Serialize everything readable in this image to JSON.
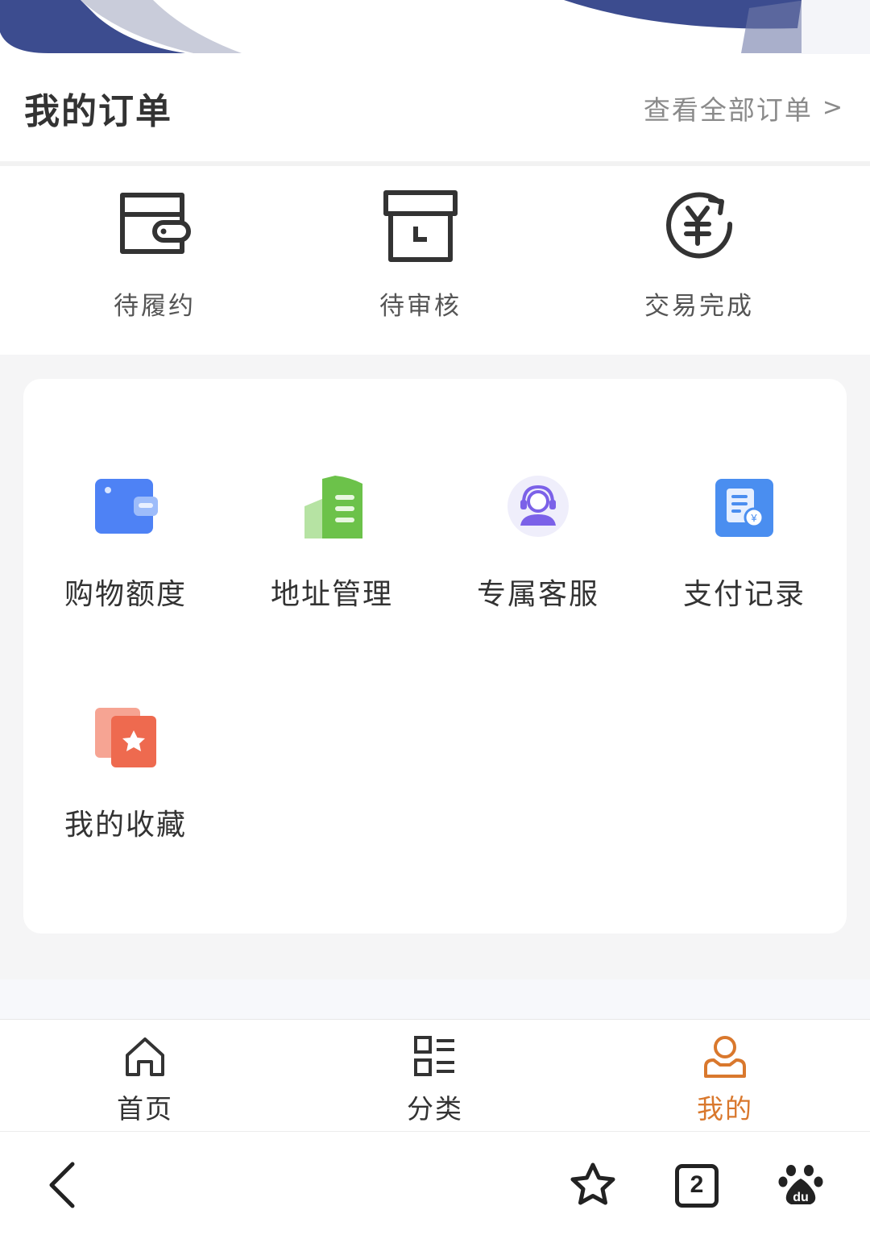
{
  "orders": {
    "title": "我的订单",
    "view_all": "查看全部订单",
    "view_all_chevron": ">",
    "statuses": [
      {
        "label": "待履约",
        "icon": "wallet-icon"
      },
      {
        "label": "待审核",
        "icon": "clock-box-icon"
      },
      {
        "label": "交易完成",
        "icon": "yuan-refresh-icon"
      }
    ]
  },
  "services": {
    "items": [
      {
        "label": "购物额度",
        "icon": "card-icon",
        "color": "#4e82f5"
      },
      {
        "label": "地址管理",
        "icon": "building-icon",
        "color": "#6cc24a"
      },
      {
        "label": "专属客服",
        "icon": "customer-service-icon",
        "color": "#7b61e8"
      },
      {
        "label": "支付记录",
        "icon": "payment-record-icon",
        "color": "#4a8ef0"
      },
      {
        "label": "我的收藏",
        "icon": "favorite-icon",
        "color": "#ee6a4f"
      }
    ]
  },
  "tabbar": {
    "items": [
      {
        "label": "首页",
        "icon": "home-icon",
        "active": false
      },
      {
        "label": "分类",
        "icon": "category-icon",
        "active": false
      },
      {
        "label": "我的",
        "icon": "user-icon",
        "active": true
      }
    ],
    "active_color": "#d9782d"
  },
  "browser": {
    "tab_count": "2",
    "icons": [
      "back-icon",
      "star-icon",
      "tabs-icon",
      "baidu-paw-icon"
    ]
  }
}
